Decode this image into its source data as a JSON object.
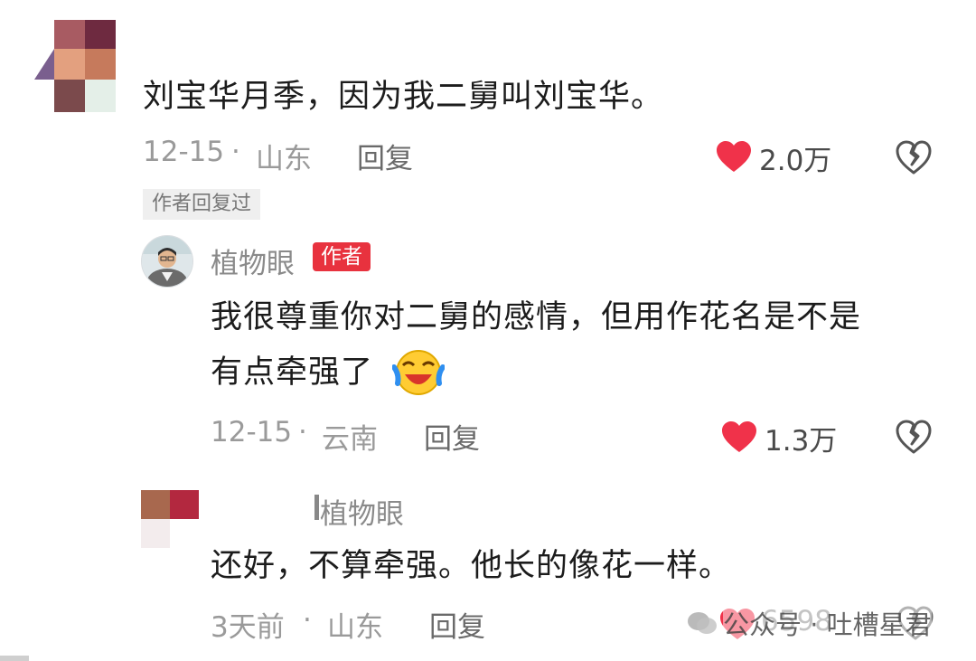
{
  "comment1": {
    "text": "刘宝华月季，因为我二舅叫刘宝华。",
    "date": "12-15",
    "dot": "·",
    "location": "山东",
    "reply_label": "回复",
    "likes": "2.0万",
    "author_replied_badge": "作者回复过"
  },
  "reply1": {
    "username": "植物眼",
    "author_tag": "作者",
    "text_line1": "我很尊重你对二舅的感情，但用作花名是不是",
    "text_line2": "有点牵强了",
    "date": "12-15",
    "dot": "·",
    "location": "云南",
    "reply_label": "回复",
    "likes": "1.3万"
  },
  "reply2": {
    "reply_to": "植物眼",
    "text": "还好，不算牵强。他长的像花一样。",
    "date": "3天前",
    "dot": "·",
    "location": "山东",
    "reply_label": "回复",
    "likes": "6598"
  },
  "watermark": {
    "text": "公众号 · 吐槽星君"
  },
  "colors": {
    "heart": "#f0324a",
    "author_tag": "#e8323e"
  }
}
